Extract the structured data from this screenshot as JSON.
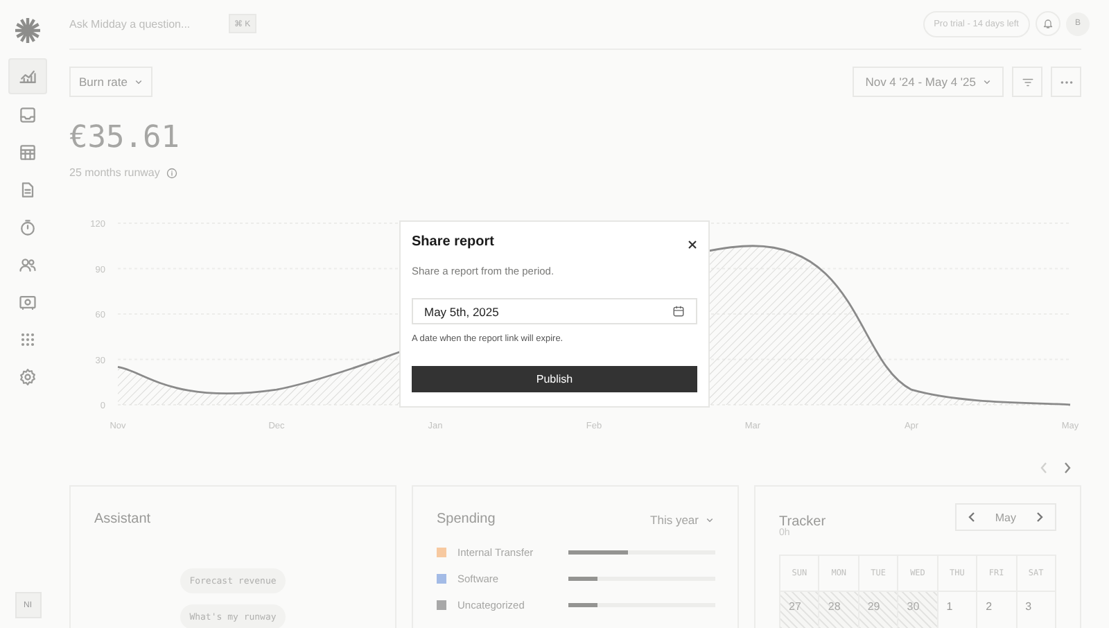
{
  "sidebar": {
    "items": [
      {
        "kind": "chart",
        "selected": true
      },
      {
        "kind": "inbox",
        "selected": false
      },
      {
        "kind": "table",
        "selected": false
      },
      {
        "kind": "document",
        "selected": false
      },
      {
        "kind": "timer",
        "selected": false
      },
      {
        "kind": "users",
        "selected": false
      },
      {
        "kind": "vault",
        "selected": false
      },
      {
        "kind": "apps",
        "selected": false
      },
      {
        "kind": "settings",
        "selected": false
      }
    ],
    "user_initials": "NI"
  },
  "top_bar": {
    "search_placeholder": "Ask Midday a question...",
    "shortcut": "⌘ K",
    "trial_badge": "Pro trial - 14 days left",
    "avatar_initial": "B"
  },
  "toolbar": {
    "metric_select": "Burn rate",
    "date_range": "Nov 4 '24 - May 4 '25"
  },
  "summary": {
    "amount": "€35.61",
    "runway": "25 months runway"
  },
  "chart_data": {
    "type": "area",
    "categories": [
      "Nov",
      "Dec",
      "Jan",
      "Feb",
      "Mar",
      "Apr",
      "May"
    ],
    "ylim": [
      0,
      120
    ],
    "yticks": [
      0,
      30,
      60,
      90,
      120
    ],
    "grid": true,
    "series": [
      {
        "color": "#8a8a8a",
        "values": [
          25,
          10,
          null,
          null,
          105,
          10,
          0
        ]
      }
    ]
  },
  "pager": {
    "previous_disabled": true,
    "next_disabled": false
  },
  "cards": {
    "assistant": {
      "title": "Assistant",
      "suggestions": [
        "Forecast revenue",
        "What's my runway"
      ]
    },
    "spending": {
      "title": "Spending",
      "period": "This year",
      "items": [
        {
          "label": "Internal Transfer",
          "color": "#f7c9a0",
          "level": 0.41
        },
        {
          "label": "Software",
          "color": "#a3bbe6",
          "level": 0.2
        },
        {
          "label": "Uncategorized",
          "color": "#a8a8a8",
          "level": 0.2
        }
      ]
    },
    "tracker": {
      "title": "Tracker",
      "total": "0h",
      "month": "May",
      "weekdays": [
        "SUN",
        "MON",
        "TUE",
        "WED",
        "THU",
        "FRI",
        "SAT"
      ],
      "days": [
        {
          "label": "27",
          "outside": true
        },
        {
          "label": "28",
          "outside": true
        },
        {
          "label": "29",
          "outside": true
        },
        {
          "label": "30",
          "outside": true
        },
        {
          "label": "1",
          "outside": false
        },
        {
          "label": "2",
          "outside": false
        },
        {
          "label": "3",
          "outside": false
        }
      ]
    }
  },
  "modal": {
    "title": "Share report",
    "description": "Share a report from the period.",
    "date_value": "May 5th, 2025",
    "hint": "A date when the report link will expire.",
    "button": "Publish"
  }
}
